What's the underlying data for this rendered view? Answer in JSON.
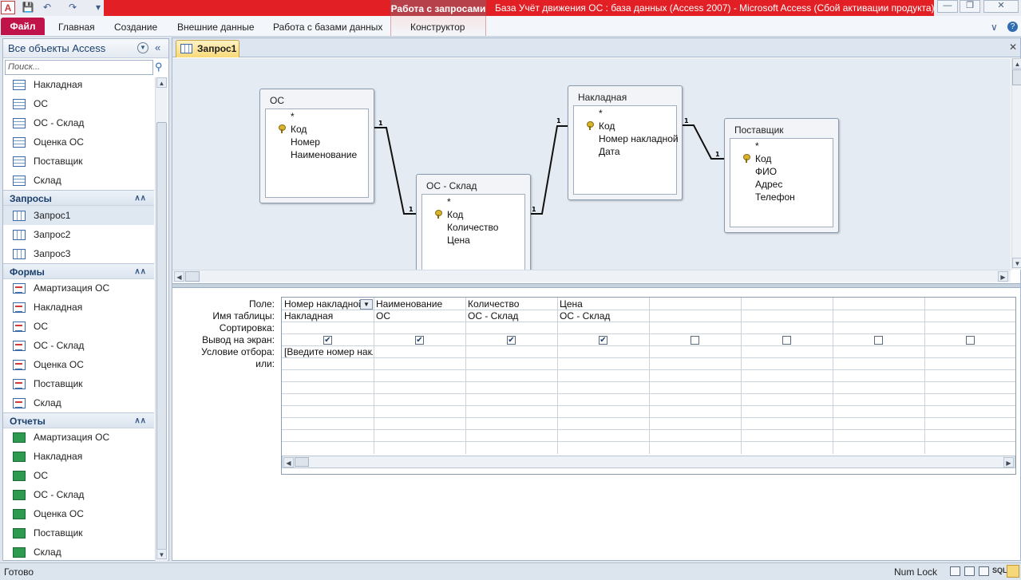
{
  "window": {
    "title": "База Учёт движения ОС : база данных (Access 2007)  -  Microsoft Access (Сбой активации продукта)",
    "context_tab_group": "Работа с запросами",
    "app_icon": "access-app-icon"
  },
  "ribbon": {
    "tabs": [
      "Файл",
      "Главная",
      "Создание",
      "Внешние данные",
      "Работа с базами данных",
      "Конструктор"
    ]
  },
  "nav": {
    "header": "Все объекты Access",
    "search_placeholder": "Поиск...",
    "tables": [
      "Накладная",
      "ОС",
      "ОС - Склад",
      "Оценка ОС",
      "Поставщик",
      "Склад"
    ],
    "groups": {
      "queries": {
        "label": "Запросы",
        "items": [
          "Запрос1",
          "Запрос2",
          "Запрос3"
        ]
      },
      "forms": {
        "label": "Формы",
        "items": [
          "Амартизация ОС",
          "Накладная",
          "ОС",
          "ОС - Склад",
          "Оценка ОС",
          "Поставщик",
          "Склад"
        ]
      },
      "reports": {
        "label": "Отчеты",
        "items": [
          "Амартизация ОС",
          "Накладная",
          "ОС",
          "ОС - Склад",
          "Оценка ОС",
          "Поставщик",
          "Склад"
        ]
      }
    }
  },
  "doc": {
    "tab_label": "Запрос1"
  },
  "tables": [
    {
      "name": "ОС",
      "fields": [
        "*",
        "Код",
        "Номер",
        "Наименование"
      ]
    },
    {
      "name": "ОС - Склад",
      "fields": [
        "*",
        "Код",
        "Количество",
        "Цена"
      ]
    },
    {
      "name": "Накладная",
      "fields": [
        "*",
        "Код",
        "Номер накладной",
        "Дата"
      ]
    },
    {
      "name": "Поставщик",
      "fields": [
        "*",
        "Код",
        "ФИО",
        "Адрес",
        "Телефон"
      ]
    }
  ],
  "relations": {
    "one_label": "1"
  },
  "grid": {
    "row_labels": [
      "Поле:",
      "Имя таблицы:",
      "Сортировка:",
      "Вывод на экран:",
      "Условие отбора:",
      "или:"
    ],
    "columns": [
      {
        "field": "Номер накладной",
        "table": "Накладная",
        "show": true,
        "criteria": "[Введите номер накладной]"
      },
      {
        "field": "Наименование",
        "table": "ОС",
        "show": true,
        "criteria": ""
      },
      {
        "field": "Количество",
        "table": "ОС - Склад",
        "show": true,
        "criteria": ""
      },
      {
        "field": "Цена",
        "table": "ОС - Склад",
        "show": true,
        "criteria": ""
      },
      {
        "field": "",
        "table": "",
        "show": false,
        "criteria": ""
      },
      {
        "field": "",
        "table": "",
        "show": false,
        "criteria": ""
      },
      {
        "field": "",
        "table": "",
        "show": false,
        "criteria": ""
      },
      {
        "field": "",
        "table": "",
        "show": false,
        "criteria": ""
      }
    ]
  },
  "status": {
    "left": "Готово",
    "num_lock": "Num Lock",
    "sql_label": "SQL"
  }
}
